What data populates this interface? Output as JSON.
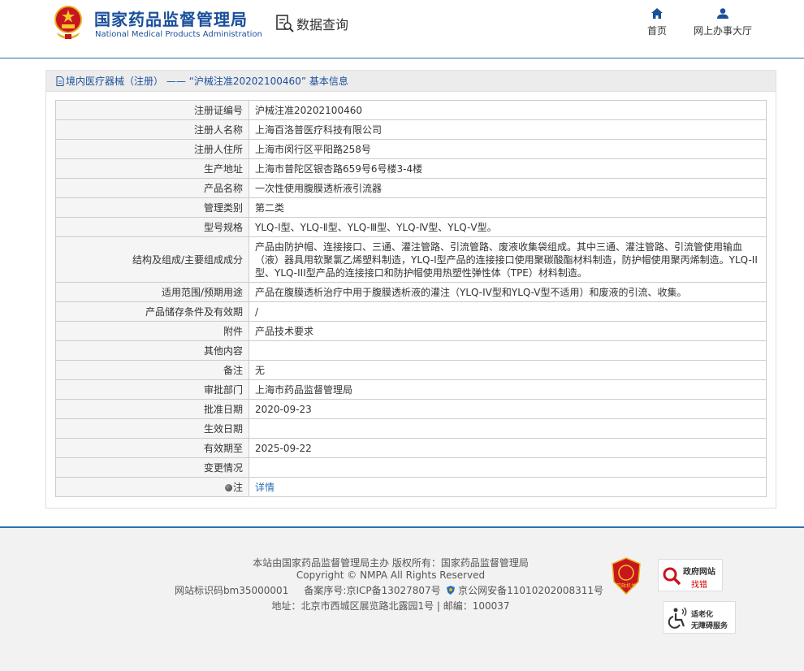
{
  "header": {
    "logo_cn": "国家药品监督管理局",
    "logo_en": "National Medical Products Administration",
    "data_query": "数据查询",
    "nav": [
      {
        "label": "首页",
        "icon": "home-icon"
      },
      {
        "label": "网上办事大厅",
        "icon": "user-icon"
      }
    ]
  },
  "breadcrumb": "境内医疗器械（注册） —— “沪械注准20202100460” 基本信息",
  "record": [
    {
      "label": "注册证编号",
      "value": "沪械注准20202100460"
    },
    {
      "label": "注册人名称",
      "value": "上海百洛普医疗科技有限公司"
    },
    {
      "label": "注册人住所",
      "value": "上海市闵行区平阳路258号"
    },
    {
      "label": "生产地址",
      "value": "上海市普陀区银杏路659号6号楼3-4楼"
    },
    {
      "label": "产品名称",
      "value": "一次性使用腹膜透析液引流器"
    },
    {
      "label": "管理类别",
      "value": "第二类"
    },
    {
      "label": "型号规格",
      "value": "YLQ-Ⅰ型、YLQ-Ⅱ型、YLQ-Ⅲ型、YLQ-Ⅳ型、YLQ-Ⅴ型。"
    },
    {
      "label": "结构及组成/主要组成成分",
      "value": "产品由防护帽、连接接口、三通、灌注管路、引流管路、废液收集袋组成。其中三通、灌注管路、引流管使用输血（液）器具用软聚氯乙烯塑料制造，YLQ-I型产品的连接接口使用聚碳酸酯材料制造，防护帽使用聚丙烯制造。YLQ-II型、YLQ-III型产品的连接接口和防护帽使用热塑性弹性体（TPE）材料制造。"
    },
    {
      "label": "适用范围/预期用途",
      "value": "产品在腹膜透析治疗中用于腹膜透析液的灌注（YLQ-IV型和YLQ-V型不适用）和废液的引流、收集。"
    },
    {
      "label": "产品储存条件及有效期",
      "value": "/"
    },
    {
      "label": "附件",
      "value": "产品技术要求"
    },
    {
      "label": "其他内容",
      "value": ""
    },
    {
      "label": "备注",
      "value": "无"
    },
    {
      "label": "审批部门",
      "value": "上海市药品监督管理局"
    },
    {
      "label": "批准日期",
      "value": "2020-09-23"
    },
    {
      "label": "生效日期",
      "value": ""
    },
    {
      "label": "有效期至",
      "value": "2025-09-22"
    },
    {
      "label": "变更情况",
      "value": ""
    },
    {
      "label": "注",
      "value": "详情"
    }
  ],
  "footer": {
    "line1": "本站由国家药品监督管理局主办 版权所有：国家药品监督管理局",
    "line2": "Copyright © NMPA All Rights Reserved",
    "line3a": "网站标识码bm35000001",
    "line3b": "备案序号:京ICP备13027807号",
    "line3c": "京公网安备11010202008311号",
    "line4": "地址：北京市西城区展览路北露园1号 | 邮编：100037",
    "badge_red": "党政机关",
    "badge_gov_1": "政府网站",
    "badge_gov_2": "找错",
    "badge_acc_1": "适老化",
    "badge_acc_2": "无障碍服务"
  }
}
